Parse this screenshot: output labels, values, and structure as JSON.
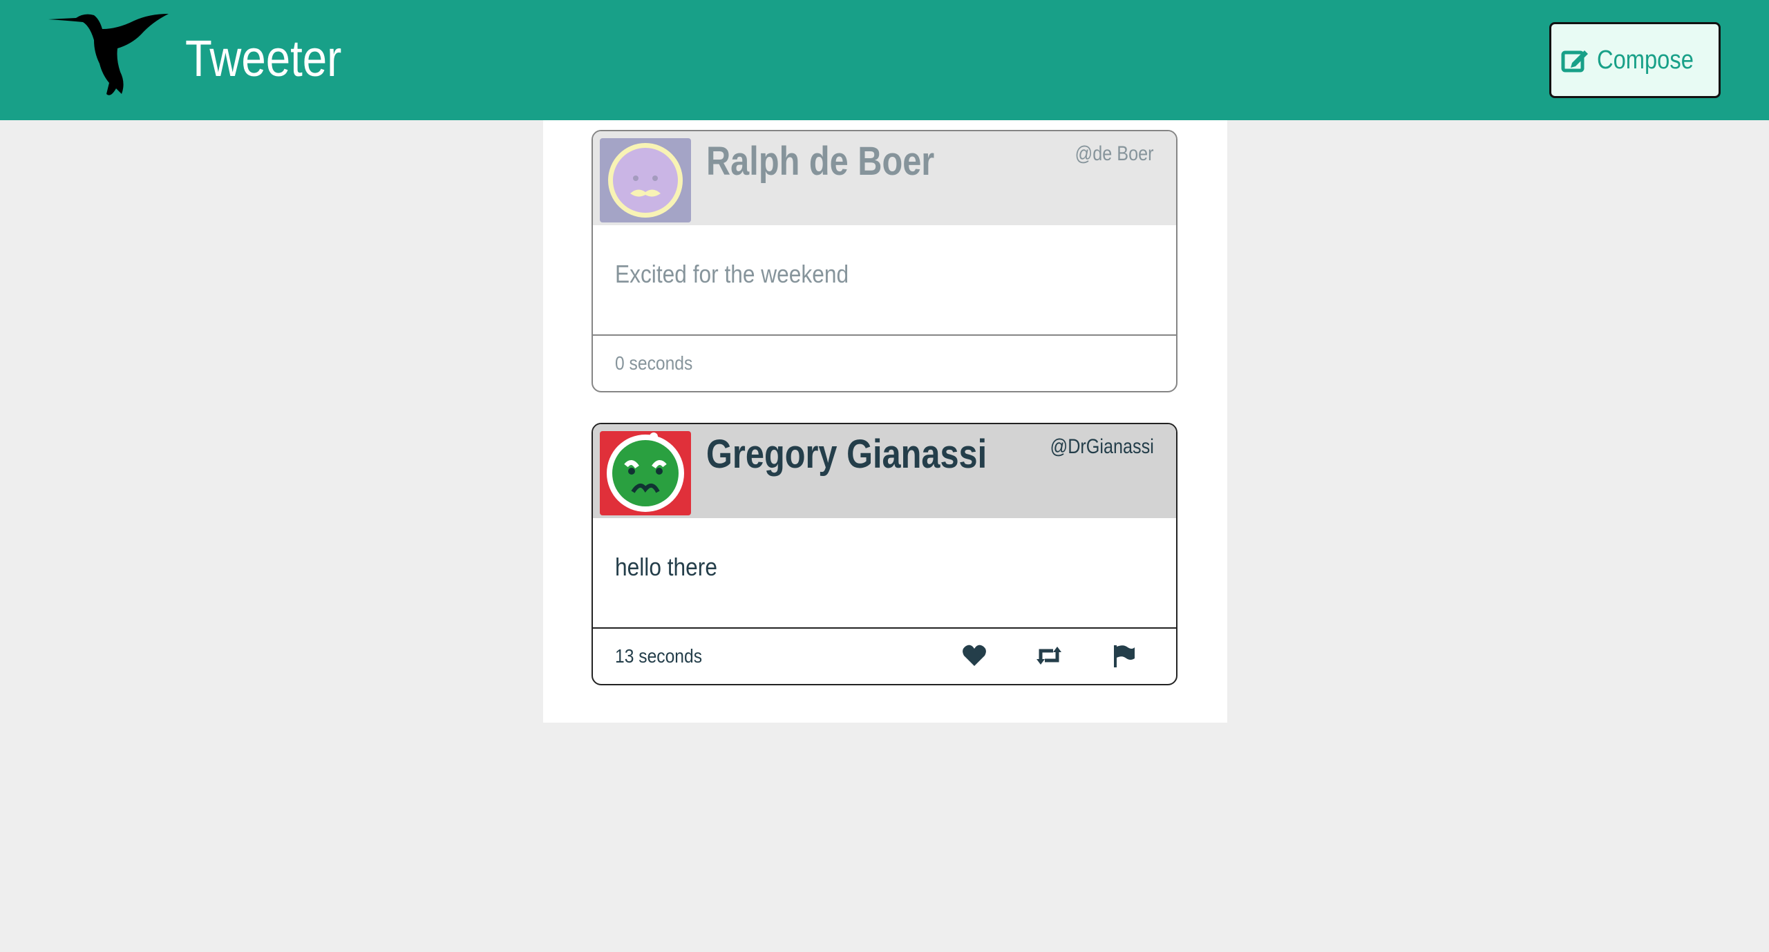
{
  "header": {
    "brand": "Tweeter",
    "compose_label": "Compose",
    "bg_color": "#18a088"
  },
  "tweets": [
    {
      "name": "Ralph de Boer",
      "handle": "@de Boer",
      "text": "Excited for the weekend",
      "time": "0 seconds",
      "avatar": "purple-mustache-face-avatar"
    },
    {
      "name": "Gregory Gianassi",
      "handle": "@DrGianassi",
      "text": "hello there",
      "time": "13 seconds",
      "avatar": "green-frowning-face-avatar",
      "actions": [
        "heart-icon",
        "retweet-icon",
        "flag-icon"
      ]
    }
  ]
}
